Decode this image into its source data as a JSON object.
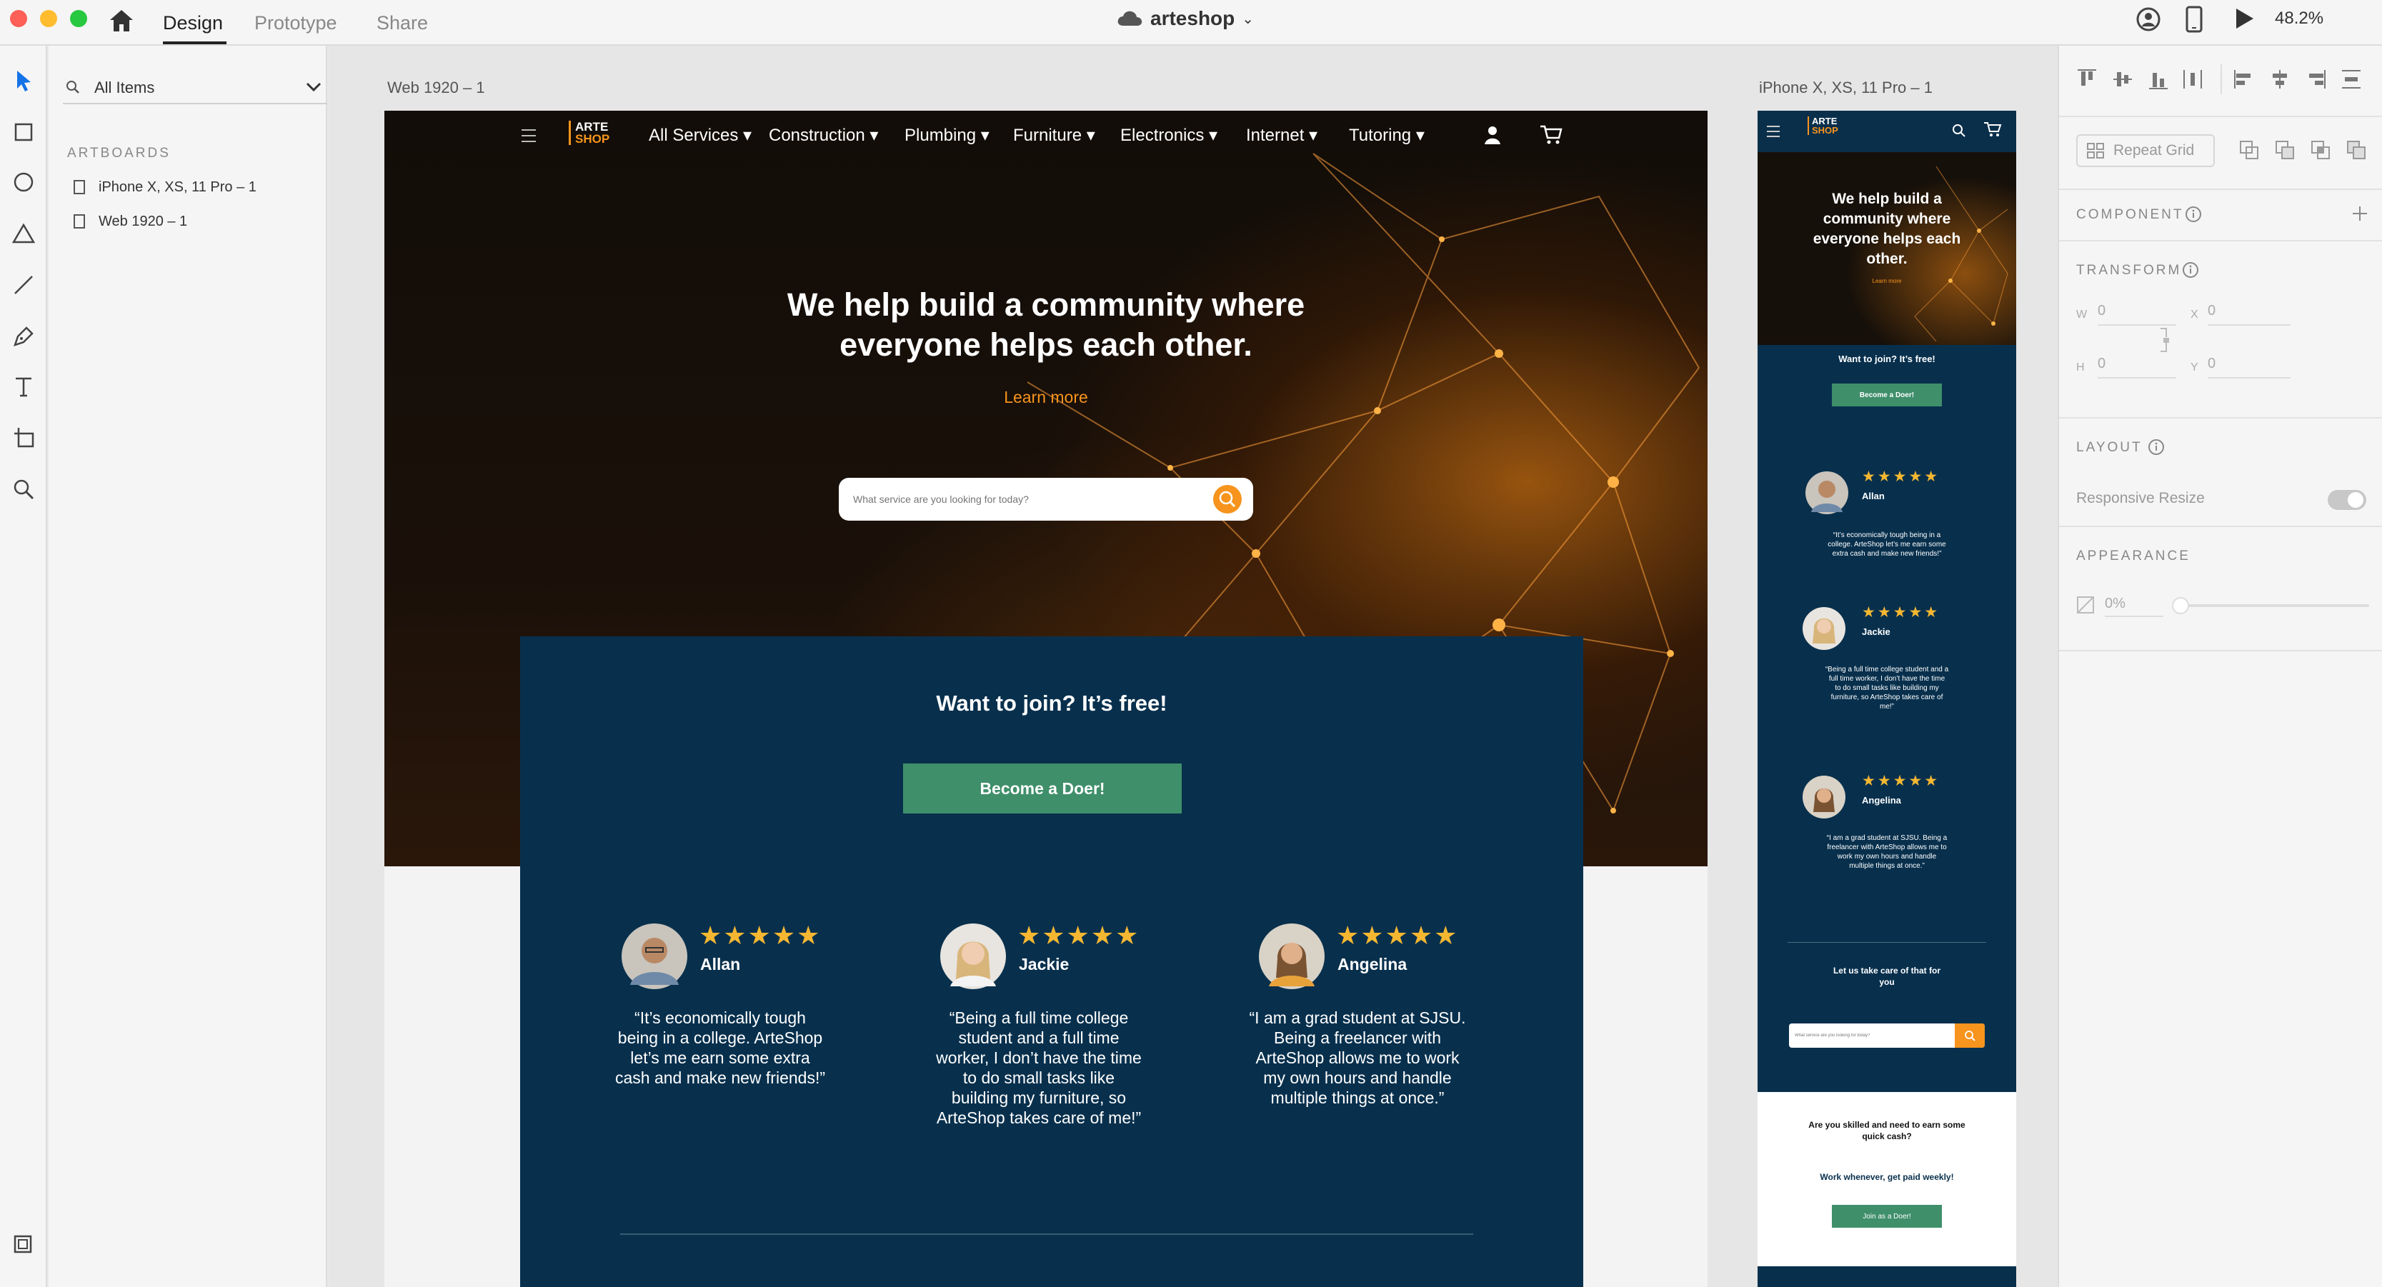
{
  "titlebar": {
    "tabs": [
      {
        "label": "Design"
      },
      {
        "label": "Prototype"
      },
      {
        "label": "Share"
      }
    ],
    "doc_title": "arteshop",
    "zoom": "48.2%"
  },
  "layers": {
    "filter_label": "All Items",
    "section_label": "ARTBOARDS",
    "artboards": [
      {
        "label": "iPhone X, XS, 11 Pro – 1"
      },
      {
        "label": "Web 1920 – 1"
      }
    ]
  },
  "canvas": {
    "web_label": "Web 1920 – 1",
    "phone_label": "iPhone X, XS, 11 Pro – 1"
  },
  "site": {
    "logo_line1": "ARTE",
    "logo_line2": "SHOP",
    "nav": [
      "All Services ▾",
      "Construction ▾",
      "Plumbing ▾",
      "Furniture ▾",
      "Electronics ▾",
      "Internet ▾",
      "Tutoring ▾"
    ],
    "hero_title_l1": "We help build a community where",
    "hero_title_l2": "everyone helps each other.",
    "learn_more": "Learn more",
    "search_placeholder": "What service are you looking for today?",
    "join_title": "Want to join? It’s free!",
    "join_button": "Become a Doer!",
    "stars": "★★★★★",
    "testimonials": [
      {
        "name": "Allan",
        "quote_lines": [
          "“It’s economically tough",
          "being in a college. ArteShop",
          "let’s me earn some extra",
          "cash and make new friends!”"
        ]
      },
      {
        "name": "Jackie",
        "quote_lines": [
          "“Being a full time college",
          "student and a full time",
          "worker, I don’t have the time",
          "to do small tasks like",
          "building my furniture, so",
          "ArteShop takes care of me!”"
        ]
      },
      {
        "name": "Angelina",
        "quote_lines": [
          "“I am a grad student at SJSU.",
          "Being a freelancer with",
          "ArteShop allows me to work",
          "my own hours and handle",
          "multiple things at once.”"
        ]
      }
    ]
  },
  "phone_site": {
    "hero_lines": [
      "We help build a",
      "community where",
      "everyone helps each",
      "other."
    ],
    "learn_more": "Learn more",
    "join_title": "Want to join? It’s free!",
    "join_button": "Become a Doer!",
    "quotes": [
      [
        "“It’s economically tough being in a",
        "college. ArteShop let’s me earn some",
        "extra cash and make new friends!”"
      ],
      [
        "“Being a full time college student and a",
        "full time worker, I don’t have the time",
        "to do small tasks like building my",
        "furniture, so ArteShop takes care of",
        "me!”"
      ],
      [
        "“I am a grad student at SJSU. Being a",
        "freelancer with ArteShop allows me to",
        "work my own hours and handle",
        "multiple things at once.”"
      ]
    ],
    "take_care_l1": "Let us take care of that for",
    "take_care_l2": "you",
    "search_placeholder": "What service are you looking for today?",
    "skilled_l1": "Are you skilled and need to earn some",
    "skilled_l2": "quick cash?",
    "work_whenever": "Work whenever, get paid weekly!",
    "join_doer": "Join as a Doer!"
  },
  "props": {
    "repeat_grid": "Repeat Grid",
    "component": "COMPONENT",
    "transform": "TRANSFORM",
    "w_label": "W",
    "w_val": "0",
    "x_label": "X",
    "x_val": "0",
    "h_label": "H",
    "h_val": "0",
    "y_label": "Y",
    "y_val": "0",
    "layout": "LAYOUT",
    "responsive_resize": "Responsive Resize",
    "appearance": "APPEARANCE",
    "opacity": "0%"
  },
  "colors": {
    "panel_navy": "#08304d",
    "accent_green": "#3f8f6a",
    "accent_orange": "#f7941d",
    "star_gold": "#f5b731"
  }
}
